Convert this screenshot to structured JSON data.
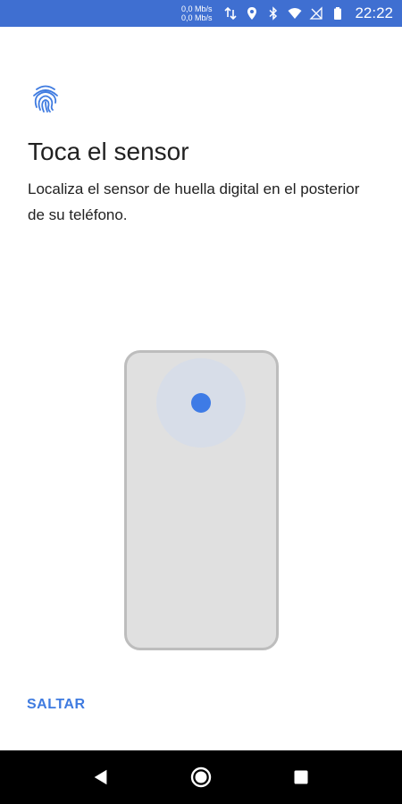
{
  "status_bar": {
    "net_speed_up": "0,0 Mb/s",
    "net_speed_down": "0,0 Mb/s",
    "time": "22:22",
    "icons": [
      "data-transfer-icon",
      "location-icon",
      "bluetooth-icon",
      "wifi-icon",
      "no-signal-icon",
      "battery-icon"
    ]
  },
  "content": {
    "icon": "fingerprint-icon",
    "title": "Toca el sensor",
    "description": "Localiza el sensor de huella digital en el posterior de su teléfono."
  },
  "illustration": {
    "phone_color": "#e0e0e0",
    "sensor_color": "#3e7be6"
  },
  "actions": {
    "skip_label": "SALTAR"
  },
  "nav_bar": {
    "buttons": [
      "back-icon",
      "home-icon",
      "recents-icon"
    ]
  },
  "colors": {
    "status_bar": "#3f6fd1",
    "accent": "#3f7be0"
  }
}
